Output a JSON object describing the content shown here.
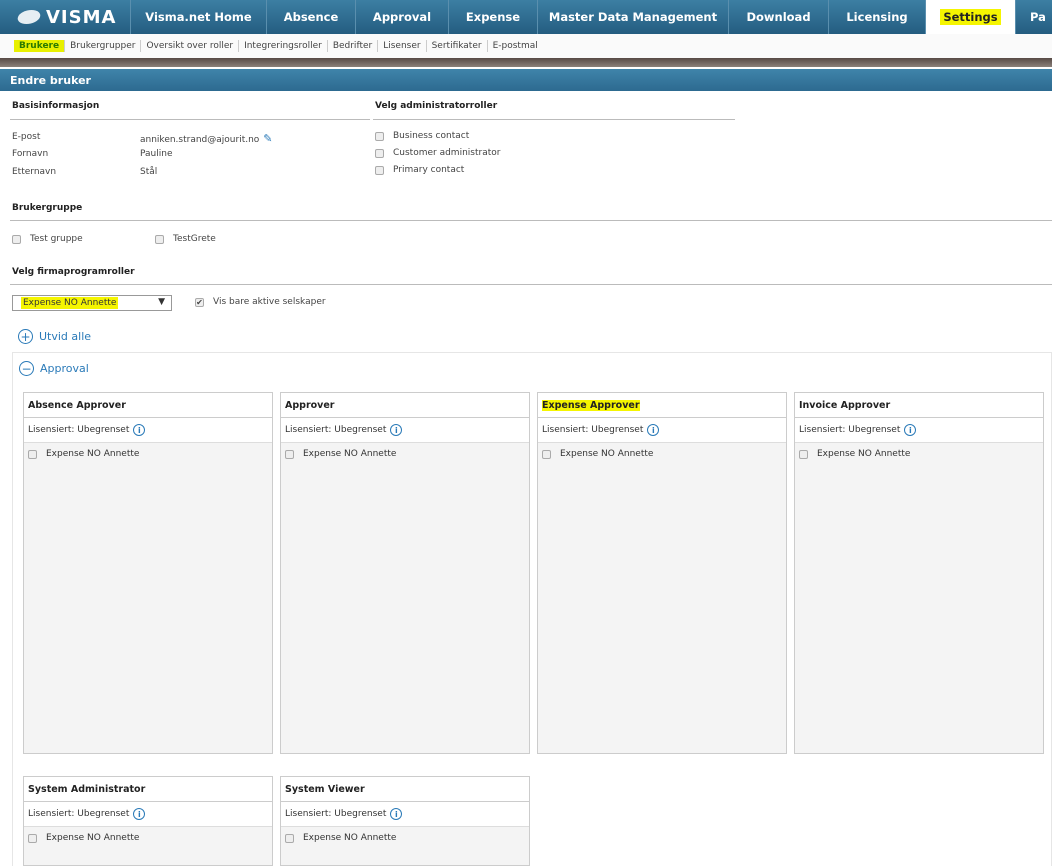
{
  "nav": {
    "logo": "VISMA",
    "items": [
      "Visma.net Home",
      "Absence",
      "Approval",
      "Expense",
      "Master Data Management",
      "Download",
      "Licensing",
      "Settings",
      "Pa"
    ],
    "active": "Settings"
  },
  "subnav": [
    "Brukere",
    "Brukergrupper",
    "Oversikt over roller",
    "Integreringsroller",
    "Bedrifter",
    "Lisenser",
    "Sertifikater",
    "E-postmal"
  ],
  "page_title": "Endre bruker",
  "basis": {
    "title": "Basisinformasjon",
    "fields": [
      {
        "label": "E-post",
        "value": "anniken.strand@ajourit.no"
      },
      {
        "label": "Fornavn",
        "value": "Pauline"
      },
      {
        "label": "Etternavn",
        "value": "Stål"
      }
    ]
  },
  "admin": {
    "title": "Velg administratorroller",
    "roles": [
      "Business contact",
      "Customer administrator",
      "Primary contact"
    ]
  },
  "group": {
    "title": "Brukergruppe",
    "items": [
      "Test gruppe",
      "TestGrete"
    ]
  },
  "firm": {
    "title": "Velg firmaprogramroller",
    "selected": "Expense NO Annette",
    "active_only": "Vis bare aktive selskaper"
  },
  "expand_all": "Utvid alle",
  "section": "Approval",
  "cards": [
    {
      "title": "Absence Approver",
      "license": "Lisensiert: Ubegrenset",
      "company": "Expense NO Annette"
    },
    {
      "title": "Approver",
      "license": "Lisensiert: Ubegrenset",
      "company": "Expense NO Annette"
    },
    {
      "title": "Expense Approver",
      "license": "Lisensiert: Ubegrenset",
      "company": "Expense NO Annette"
    },
    {
      "title": "Invoice Approver",
      "license": "Lisensiert: Ubegrenset",
      "company": "Expense NO Annette"
    },
    {
      "title": "System Administrator",
      "license": "Lisensiert: Ubegrenset",
      "company": "Expense NO Annette"
    },
    {
      "title": "System Viewer",
      "license": "Lisensiert: Ubegrenset",
      "company": "Expense NO Annette"
    }
  ]
}
